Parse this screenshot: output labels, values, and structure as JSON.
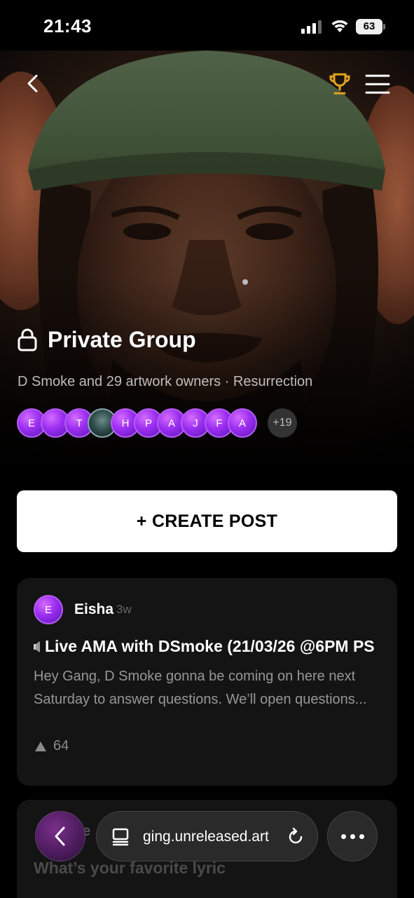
{
  "status_bar": {
    "time": "21:43",
    "battery": "63"
  },
  "group": {
    "title": "Private Group",
    "subtitle": "D Smoke and 29 artwork owners · Resurrection",
    "member_avatars": [
      "E",
      "",
      "T",
      "",
      "H",
      "P",
      "A",
      "J",
      "F",
      "A"
    ],
    "more_members": "+19"
  },
  "create_post": {
    "label": "+ CREATE POST"
  },
  "posts": [
    {
      "author_initial": "E",
      "author": "Eisha",
      "time": "3w",
      "title": "Live AMA with DSmoke (21/03/26 @6PM PS",
      "body_line1": "Hey Gang, D Smoke gonna be coming on here next",
      "body_line2": "Saturday to answer questions. We’ll open questions...",
      "votes": "64"
    },
    {
      "author_initial": "",
      "author": "ve",
      "title": "What’s your favorite lyric"
    }
  ],
  "browser": {
    "url": "ging.unreleased.art"
  },
  "icons": {
    "back": "chevron-left-icon",
    "trophy": "trophy-icon",
    "menu": "hamburger-menu-icon",
    "lock": "lock-icon",
    "upvote": "upvote-triangle-icon",
    "tabs": "tabs-icon",
    "reload": "reload-icon",
    "more": "more-dots-icon"
  },
  "colors": {
    "accent_purple": "#9b2ef0",
    "trophy_gold": "#e0a41e",
    "background": "#000000",
    "card": "#141414"
  }
}
